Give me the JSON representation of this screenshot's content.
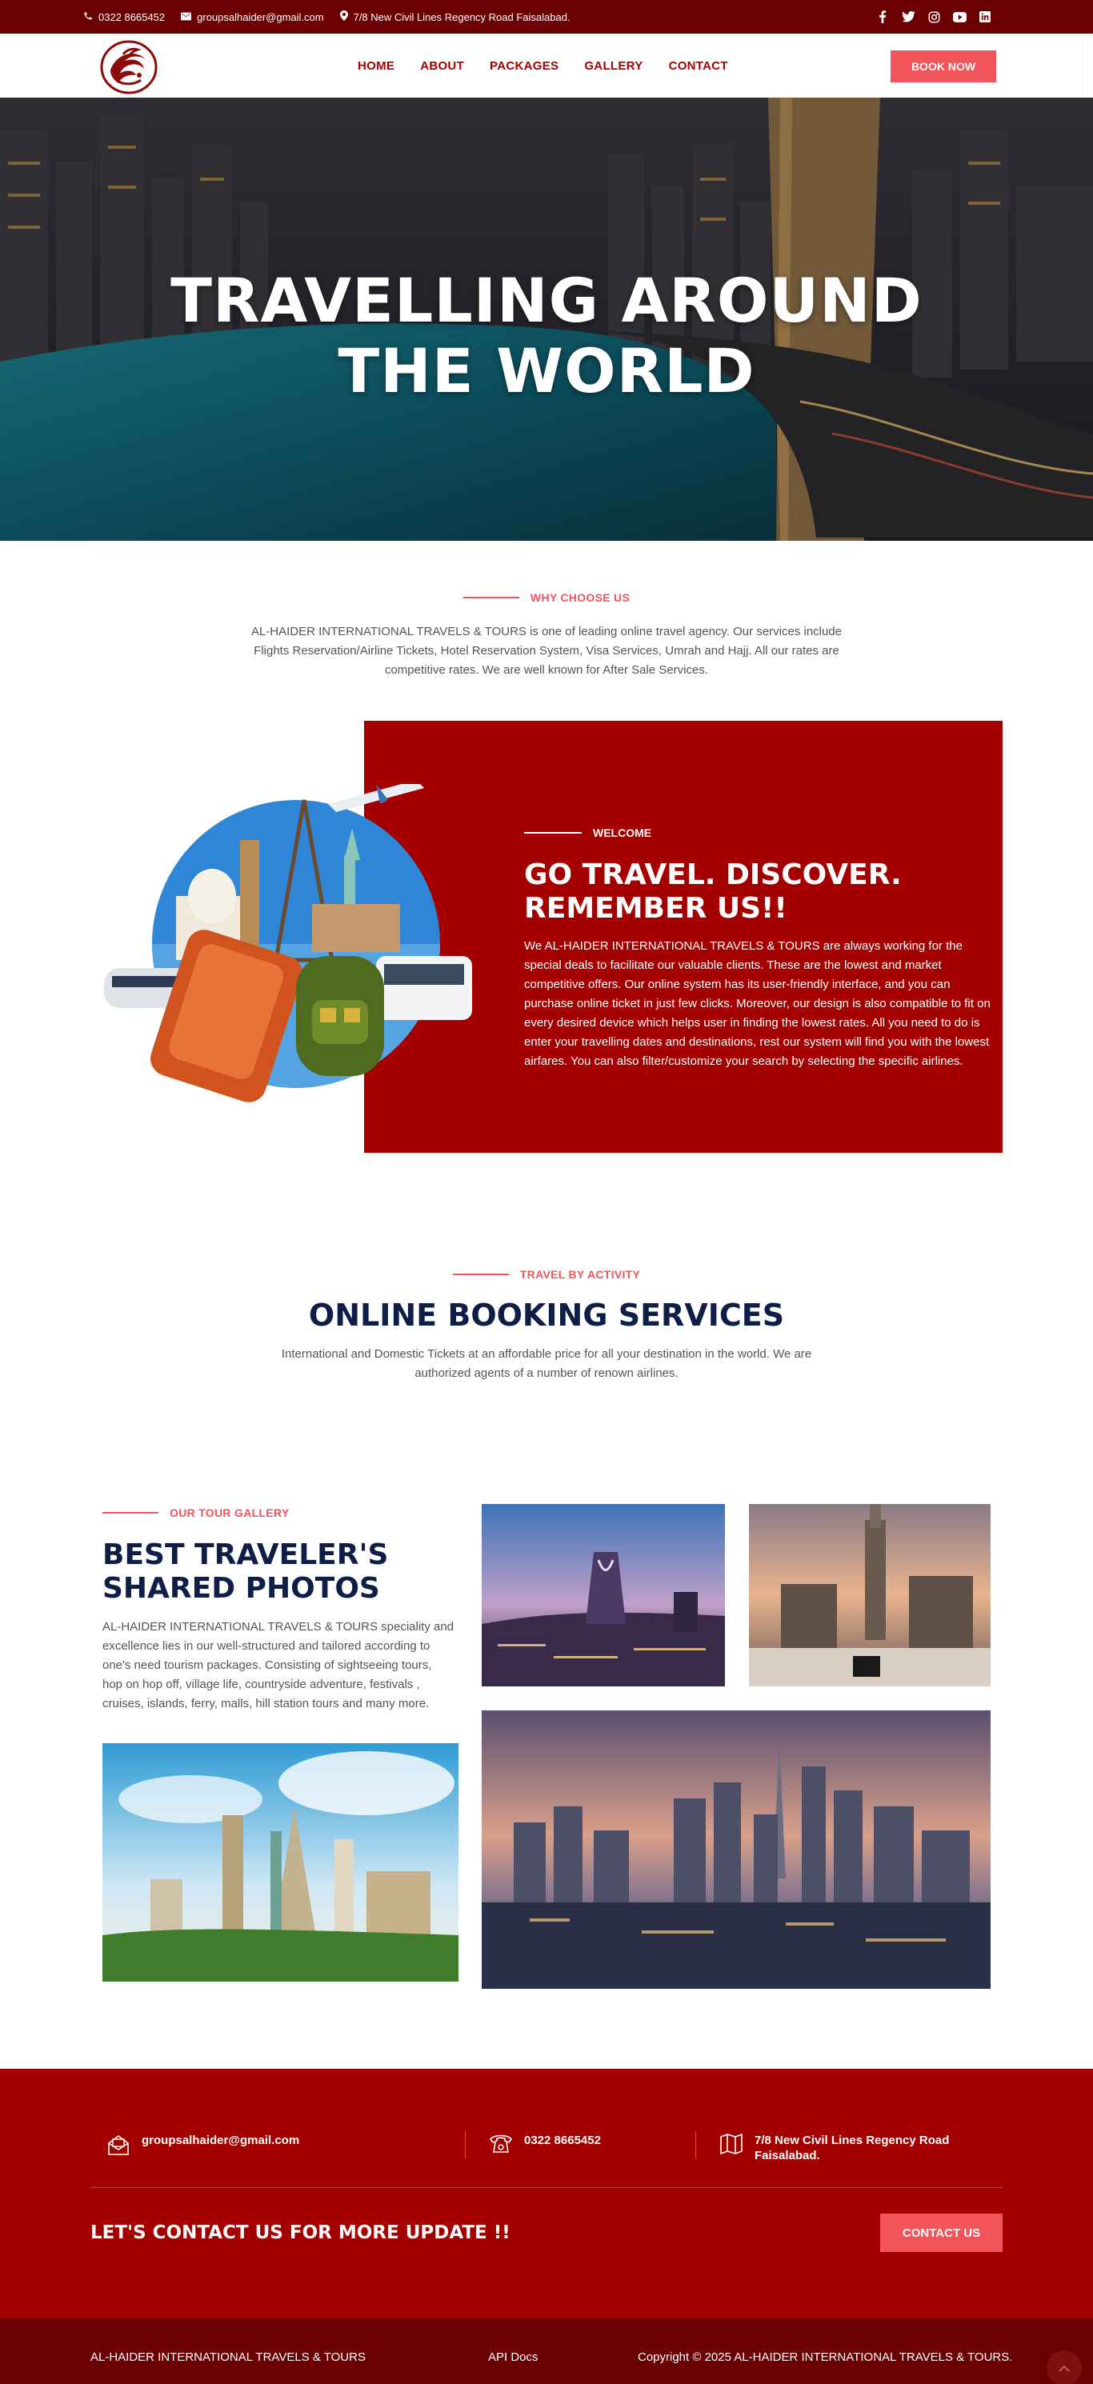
{
  "topbar": {
    "phone": "0322 8665452",
    "email": "groupsalhaider@gmail.com",
    "address": "7/8 New Civil Lines Regency Road Faisalabad.",
    "social_icons": [
      "facebook-icon",
      "twitter-icon",
      "instagram-icon",
      "youtube-icon",
      "linkedin-icon"
    ]
  },
  "nav": {
    "items": [
      "HOME",
      "ABOUT",
      "PACKAGES",
      "GALLERY",
      "CONTACT"
    ],
    "book_now": "BOOK NOW"
  },
  "hero": {
    "title_line1": "TRAVELLING AROUND",
    "title_line2": "THE WORLD"
  },
  "why": {
    "kicker": "WHY CHOOSE US",
    "text": "AL-HAIDER INTERNATIONAL TRAVELS & TOURS is one of leading online travel agency. Our services include Flights Reservation/Airline Tickets, Hotel Reservation System, Visa Services, Umrah and Hajj. All our rates are competitive rates. We are well known for After Sale Services."
  },
  "welcome": {
    "kicker": "WELCOME",
    "title_line1": "GO TRAVEL. DISCOVER.",
    "title_line2": "REMEMBER US!!",
    "text": "We AL-HAIDER INTERNATIONAL TRAVELS & TOURS are always working for the special deals to facilitate our valuable clients. These are the lowest and market competitive offers. Our online system has its user-friendly interface, and you can purchase online ticket in just few clicks. Moreover, our design is also compatible to fit on every desired device which helps user in finding the lowest rates. All you need to do is enter your travelling dates and destinations, rest our system will find you with the lowest airfares. You can also filter/customize your search by selecting the specific airlines."
  },
  "booking": {
    "kicker": "TRAVEL BY ACTIVITY",
    "title": "ONLINE BOOKING SERVICES",
    "text": "International and Domestic Tickets at an affordable price for all your destination in the world. We are authorized agents of a number of renown airlines."
  },
  "gallery": {
    "kicker": "OUR TOUR GALLERY",
    "title_line1": "BEST TRAVELER'S",
    "title_line2": "SHARED PHOTOS",
    "text": "AL-HAIDER INTERNATIONAL TRAVELS & TOURS speciality and excellence lies in our well-structured and tailored according to one's need tourism packages. Consisting of sightseeing tours, hop on hop off, village life, countryside adventure, festivals , cruises, islands, ferry, malls, hill station tours and many more."
  },
  "footer": {
    "email": "groupsalhaider@gmail.com",
    "phone": "0322 8665452",
    "address_line1": "7/8 New Civil Lines Regency Road",
    "address_line2": "Faisalabad.",
    "cta": "LET'S CONTACT US FOR MORE UPDATE !!",
    "contact_btn": "CONTACT US",
    "company": "AL-HAIDER INTERNATIONAL TRAVELS & TOURS",
    "api_docs": "API Docs",
    "copyright": "Copyright © 2025 AL-HAIDER INTERNATIONAL TRAVELS & TOURS."
  },
  "colors": {
    "brand_red": "#a50000",
    "dark_red": "#6a0002",
    "accent_coral": "#f2545b",
    "navy": "#0f1e46"
  }
}
